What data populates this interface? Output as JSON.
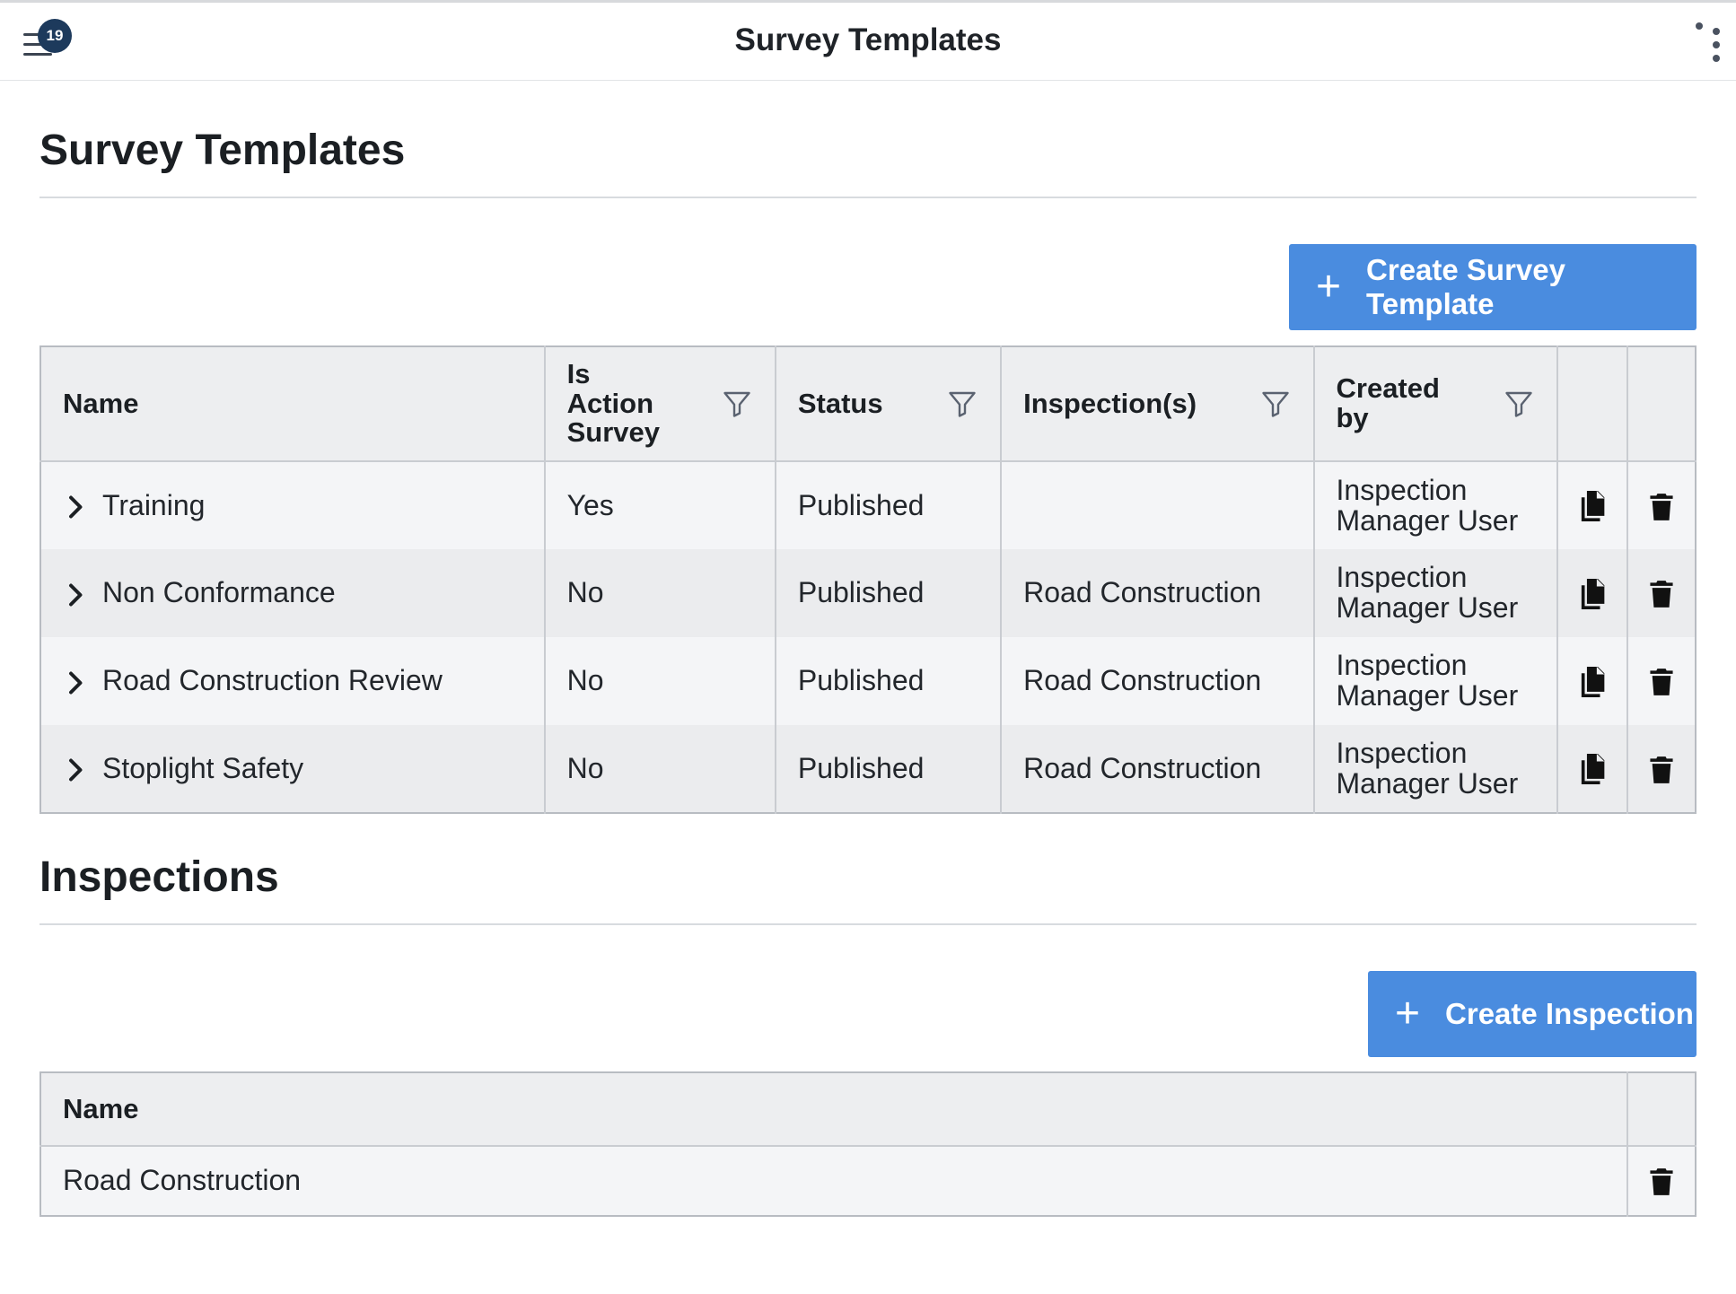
{
  "topbar": {
    "title": "Survey Templates",
    "notification_count": "19"
  },
  "templates_section": {
    "title": "Survey Templates",
    "create_button": "Create Survey Template",
    "columns": {
      "name": "Name",
      "is_action_survey_line1": "Is",
      "is_action_survey_line2": "Action",
      "is_action_survey_line3": "Survey",
      "status": "Status",
      "inspections": "Inspection(s)",
      "created_by_line1": "Created",
      "created_by_line2": "by"
    },
    "rows": [
      {
        "name": "Training",
        "is_action": "Yes",
        "status": "Published",
        "inspections": "",
        "created_by_line1": "Inspection",
        "created_by_line2": "Manager User"
      },
      {
        "name": "Non Conformance",
        "is_action": "No",
        "status": "Published",
        "inspections": "Road Construction",
        "created_by_line1": "Inspection",
        "created_by_line2": "Manager User"
      },
      {
        "name": "Road Construction Review",
        "is_action": "No",
        "status": "Published",
        "inspections": "Road Construction",
        "created_by_line1": "Inspection",
        "created_by_line2": "Manager User"
      },
      {
        "name": "Stoplight Safety",
        "is_action": "No",
        "status": "Published",
        "inspections": "Road Construction",
        "created_by_line1": "Inspection",
        "created_by_line2": "Manager User"
      }
    ]
  },
  "inspections_section": {
    "title": "Inspections",
    "create_button": "Create Inspection",
    "columns": {
      "name": "Name"
    },
    "rows": [
      {
        "name": "Road Construction"
      }
    ]
  },
  "colors": {
    "primary_button": "#4a8cdf",
    "badge": "#1d3a5c",
    "header_bg": "#edeef0"
  },
  "icons": {
    "menu": "hamburger-icon",
    "more": "kebab-icon",
    "filter": "filter-icon",
    "expand": "chevron-right-icon",
    "copy": "copy-icon",
    "delete": "trash-icon",
    "add": "plus-icon"
  }
}
